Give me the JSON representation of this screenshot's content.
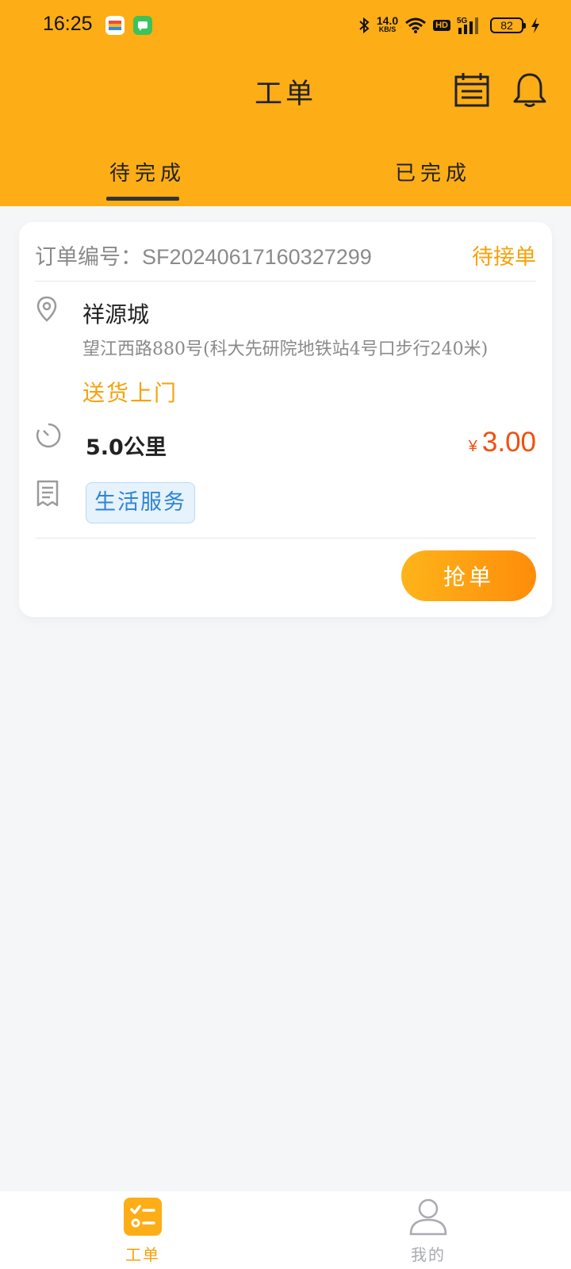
{
  "status_bar": {
    "time": "16:25",
    "speed_value": "14.0",
    "speed_unit": "KB/S",
    "hd": "HD",
    "network": "5G",
    "battery": "82"
  },
  "header": {
    "title": "工单",
    "icons": [
      "calendar-list-icon",
      "bell-icon"
    ]
  },
  "tabs": [
    {
      "label": "待完成",
      "active": true
    },
    {
      "label": "已完成",
      "active": false
    }
  ],
  "order": {
    "number_label": "订单编号：",
    "number": "SF20240617160327299",
    "status": "待接单",
    "place_name": "祥源城",
    "address": "望江西路880号(科大先研院地铁站4号口步行240米)",
    "delivery_type": "送货上门",
    "distance": "5.0公里",
    "price_symbol": "¥",
    "price": "3.00",
    "category": "生活服务",
    "action_label": "抢单"
  },
  "bottom_nav": [
    {
      "label": "工单",
      "icon": "task-list-icon",
      "active": true
    },
    {
      "label": "我的",
      "icon": "user-icon",
      "active": false
    }
  ],
  "colors": {
    "header_bg": "#fdad16",
    "accent_orange": "#f5a20a",
    "price_red": "#f24f0c",
    "tag_blue": "#2e84d8"
  }
}
